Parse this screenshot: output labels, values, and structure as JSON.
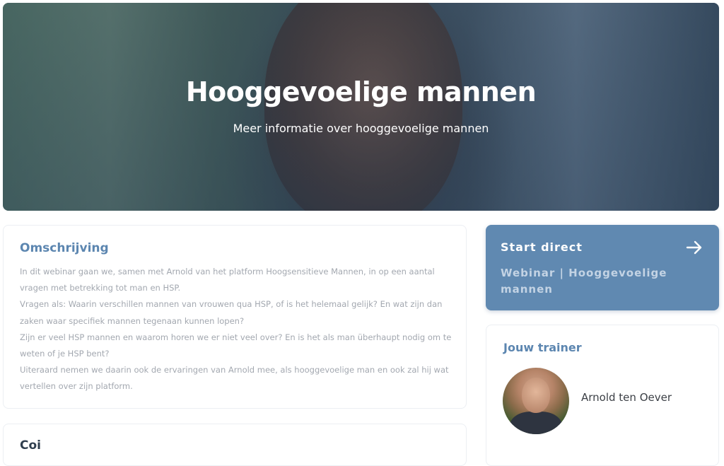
{
  "hero": {
    "title": "Hooggevoelige mannen",
    "subtitle": "Meer informatie over hooggevoelige mannen"
  },
  "description": {
    "title": "Omschrijving",
    "paragraphs": [
      "In dit webinar gaan we, samen met Arnold van het platform Hoogsensitieve Mannen, in op een aantal vragen met betrekking tot man en HSP.",
      "Vragen als: Waarin verschillen mannen van vrouwen qua HSP, of is het helemaal gelijk? En wat zijn dan zaken waar specifiek mannen tegenaan kunnen lopen?",
      "Zijn er veel HSP mannen en waarom horen we er niet veel over? En is het als man überhaupt nodig om te weten of je HSP bent?",
      "Uiteraard nemen we daarin ook de ervaringen van Arnold mee, als hooggevoelige man en ook zal hij wat vertellen over zijn platform."
    ]
  },
  "second_card": {
    "title": "Coi"
  },
  "start": {
    "title": "Start direct",
    "subtitle": "Webinar | Hooggevoelige mannen",
    "arrow_icon": "arrow-right-icon"
  },
  "trainer": {
    "title": "Jouw trainer",
    "name": "Arnold ten Oever"
  },
  "colors": {
    "accent": "#6089b1",
    "heading": "#5c86b0",
    "body_text": "#a3a8b0"
  }
}
